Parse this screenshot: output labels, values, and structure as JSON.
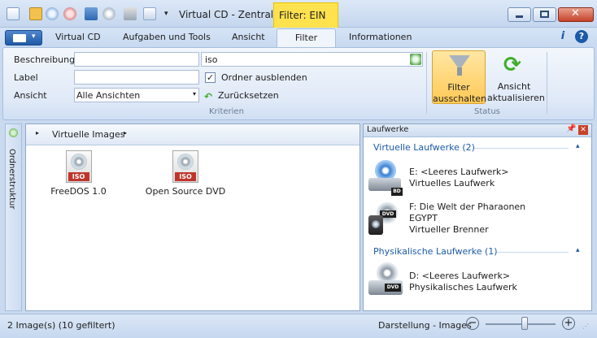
{
  "window": {
    "title": "Virtual CD - Zentrale",
    "filter_badge": "Filter: EIN"
  },
  "tabs": [
    {
      "label": "Virtual CD"
    },
    {
      "label": "Aufgaben und Tools"
    },
    {
      "label": "Ansicht"
    },
    {
      "label": "Filter",
      "active": true
    },
    {
      "label": "Informationen"
    }
  ],
  "criteria": {
    "beschreibung_label": "Beschreibung",
    "beschreibung_value": "",
    "label_label": "Label",
    "label_value": "",
    "ansicht_label": "Ansicht",
    "ansicht_value": "Alle Ansichten",
    "search_value": "iso",
    "hide_folders_label": "Ordner ausblenden",
    "hide_folders_checked": true,
    "reset_label": "Zurücksetzen",
    "group_label": "Kriterien"
  },
  "status_group": {
    "filter_off_line1": "Filter",
    "filter_off_line2": "ausschalten",
    "refresh_line1": "Ansicht",
    "refresh_line2": "aktualisieren",
    "group_label": "Status"
  },
  "sidebar": {
    "folder_structure_label": "Ordnerstruktur"
  },
  "main": {
    "breadcrumb": "Virtuelle Images",
    "items": [
      {
        "name": "FreeDOS 1.0",
        "icon_text": "ISO"
      },
      {
        "name": "Open Source DVD",
        "icon_text": "ISO"
      }
    ]
  },
  "drives_panel": {
    "title": "Laufwerke",
    "virtual_section": "Virtuelle Laufwerke (2)",
    "physical_section": "Physikalische Laufwerke (1)",
    "virtual_drives": [
      {
        "line1": "E: <Leeres Laufwerk>",
        "line2": "Virtuelles Laufwerk",
        "line3": "",
        "badge": "BD"
      },
      {
        "line1": "F: Die Welt der Pharaonen",
        "line2": "EGYPT",
        "line3": "Virtueller Brenner",
        "badge": "DVD"
      }
    ],
    "physical_drives": [
      {
        "line1": "D: <Leeres Laufwerk>",
        "line2": "Physikalisches Laufwerk",
        "badge": "DVD"
      }
    ]
  },
  "statusbar": {
    "left_text": "2 Image(s) (10 gefiltert)",
    "view_text": "Darstellung - Images",
    "zoom_level": 0.4
  },
  "colors": {
    "accent_blue": "#1b5aa8",
    "filter_yellow": "#ffe24d",
    "refresh_green": "#3fae2a"
  }
}
